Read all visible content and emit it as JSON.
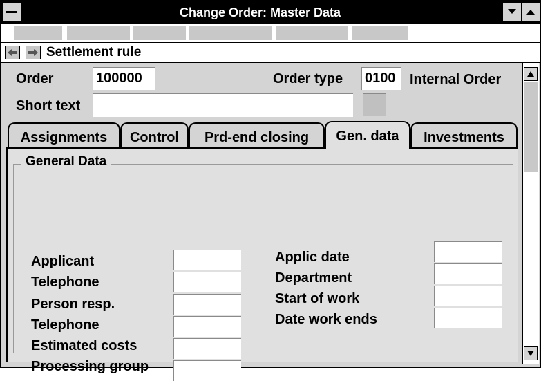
{
  "window": {
    "title": "Change Order: Master Data"
  },
  "nav": {
    "label": "Settlement rule"
  },
  "header": {
    "order_label": "Order",
    "order_value": "100000",
    "order_type_label": "Order type",
    "order_type_value": "0100",
    "order_type_text": "Internal Order",
    "short_text_label": "Short text",
    "short_text_value": ""
  },
  "tabs": [
    {
      "label": "Assignments",
      "active": false
    },
    {
      "label": "Control",
      "active": false
    },
    {
      "label": "Prd-end closing",
      "active": false
    },
    {
      "label": "Gen. data",
      "active": true
    },
    {
      "label": "Investments",
      "active": false
    }
  ],
  "general_data": {
    "title": "General Data",
    "left_fields": [
      {
        "label": "Applicant",
        "value": ""
      },
      {
        "label": "Telephone",
        "value": ""
      },
      {
        "label": "Person resp.",
        "value": ""
      },
      {
        "label": "Telephone",
        "value": ""
      },
      {
        "label": "Estimated costs",
        "value": ""
      },
      {
        "label": "Processing group",
        "value": ""
      }
    ],
    "right_fields": [
      {
        "label": "Applic date",
        "value": ""
      },
      {
        "label": "Department",
        "value": ""
      },
      {
        "label": "Start of work",
        "value": ""
      },
      {
        "label": "Date work ends",
        "value": ""
      }
    ]
  },
  "icons": {
    "system_menu": "system-menu-icon",
    "minimize": "minimize-arrow-icon",
    "maximize": "maximize-arrow-icon",
    "back": "back-arrow-icon",
    "forward": "forward-arrow-icon",
    "scroll_up": "scroll-up-arrow-icon",
    "scroll_down": "scroll-down-arrow-icon"
  }
}
